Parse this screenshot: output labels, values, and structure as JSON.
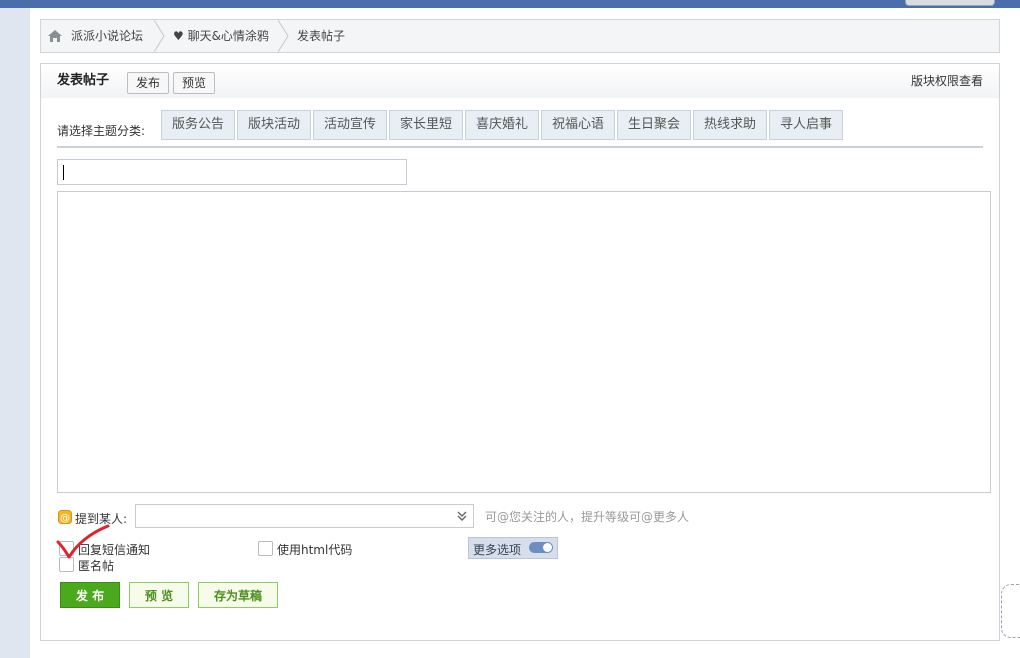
{
  "breadcrumb": {
    "home_icon": "home-icon",
    "items": [
      "派派小说论坛",
      "♥ 聊天&心情涂鸦",
      "发表帖子"
    ]
  },
  "panel": {
    "title": "发表帖子",
    "publish_small": "发布",
    "preview_small": "预览",
    "permission_link": "版块权限查看"
  },
  "topic": {
    "label": "请选择主题分类:",
    "options": [
      "版务公告",
      "版块活动",
      "活动宣传",
      "家长里短",
      "喜庆婚礼",
      "祝福心语",
      "生日聚会",
      "热线求助",
      "寻人启事"
    ]
  },
  "title_input": {
    "value": "",
    "placeholder": ""
  },
  "mention": {
    "label": "提到某人:",
    "hint": "可@您关注的人，提升等级可@更多人"
  },
  "options": {
    "sms_notify": "回复短信通知",
    "anonymous": "匿名帖",
    "use_html": "使用html代码",
    "more_options": "更多选项"
  },
  "actions": {
    "publish": "发 布",
    "preview": "预 览",
    "save_draft": "存为草稿"
  },
  "colors": {
    "topbar": "#4a6ea9",
    "publish_green": "#4aa91c",
    "annotation_red": "#e0242b"
  }
}
